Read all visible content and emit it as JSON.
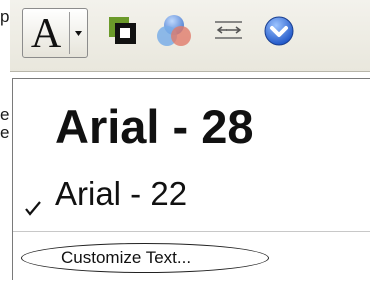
{
  "side_text": {
    "top": "p",
    "middle1": "e",
    "middle2": "e"
  },
  "toolbar": {
    "font_button_glyph": "A",
    "icons": [
      "font-dropdown-chevron",
      "shadow-icon",
      "venn-circles-icon",
      "spacing-arrows-icon",
      "down-circle-icon"
    ]
  },
  "menu": {
    "items": [
      {
        "label": "Arial - 28",
        "checked": false
      },
      {
        "label": "Arial - 22",
        "checked": true
      }
    ],
    "customize_label": "Customize Text..."
  }
}
